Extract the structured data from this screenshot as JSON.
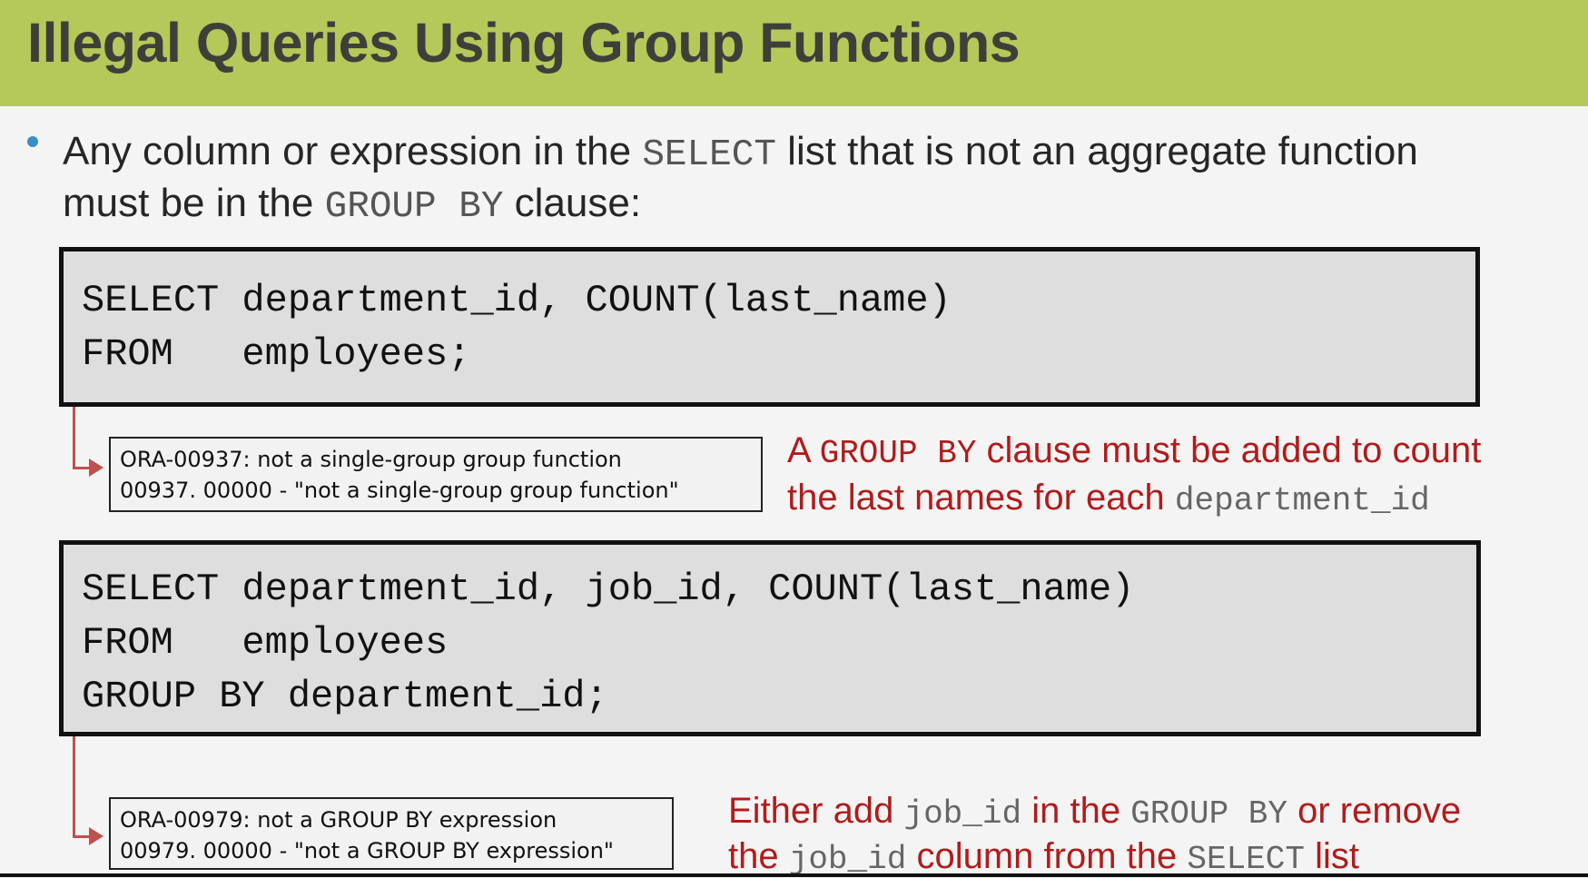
{
  "slide": {
    "title": "Illegal Queries Using Group Functions"
  },
  "bullet": {
    "line1_pre": "Any column or expression in the ",
    "line1_code": "SELECT",
    "line1_post": " list that is not an aggregate function",
    "line2_pre": "must be in the ",
    "line2_code": "GROUP BY",
    "line2_post": " clause:"
  },
  "query1": {
    "lines": [
      "SELECT department_id, COUNT(last_name)",
      "FROM   employees;"
    ]
  },
  "error1": {
    "lines": [
      "ORA-00937: not a single-group group function",
      "00937. 00000 -  \"not a single-group group function\""
    ]
  },
  "note1": {
    "a": "A ",
    "code1": "GROUP BY",
    "b": " clause must be added to count",
    "c": "the last names for each ",
    "code2": "department_id"
  },
  "query2": {
    "lines": [
      "SELECT department_id, job_id, COUNT(last_name)",
      "FROM   employees",
      "GROUP BY department_id;"
    ]
  },
  "error2": {
    "lines": [
      "ORA-00979: not a GROUP BY expression",
      "00979. 00000 -  \"not a GROUP BY expression\""
    ]
  },
  "note2": {
    "a": "Either add ",
    "code1": "job_id",
    "b": " in the ",
    "code2": "GROUP BY",
    "c": " or remove",
    "d": "the ",
    "code3": "job_id",
    "e": " column from the ",
    "code4": "SELECT",
    "f": " list"
  },
  "colors": {
    "title_bar": "#b5c85a",
    "note_red": "#b01c1c",
    "arrow": "#c0504d",
    "bullet": "#3a8fc8",
    "code_bg": "#dedede"
  }
}
